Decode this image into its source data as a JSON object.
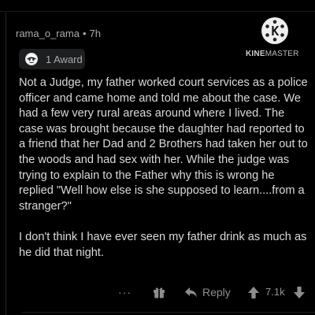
{
  "top_strip": {
    "text": "···"
  },
  "comment": {
    "author": "rama_o_rama",
    "separator": "•",
    "age": "7h",
    "award_label": "1 Award",
    "body": "Not a Judge, my father worked court services as a police officer and came home and told me about the case. We had a few very rural areas around where I lived. The case was brought because the daughter had reported to a friend that her Dad and 2 Brothers had taken her out to the woods and had sex with her.  While the judge was trying to explain to the Father why this is wrong he replied \"Well how else is she supposed to learn....from a stranger?\"\n\nI don't think I have ever seen my father drink as much as he did that night."
  },
  "watermark": {
    "brand_bold": "KINE",
    "brand_rest": "MASTER",
    "logo_icon": "kinemaster-k-icon"
  },
  "actions": {
    "more": "···",
    "reply_label": "Reply",
    "score": "7.1k"
  },
  "colors": {
    "background": "#000000",
    "text": "#d7dadc",
    "muted": "#8b8f92",
    "chip": "#1d1e20"
  }
}
